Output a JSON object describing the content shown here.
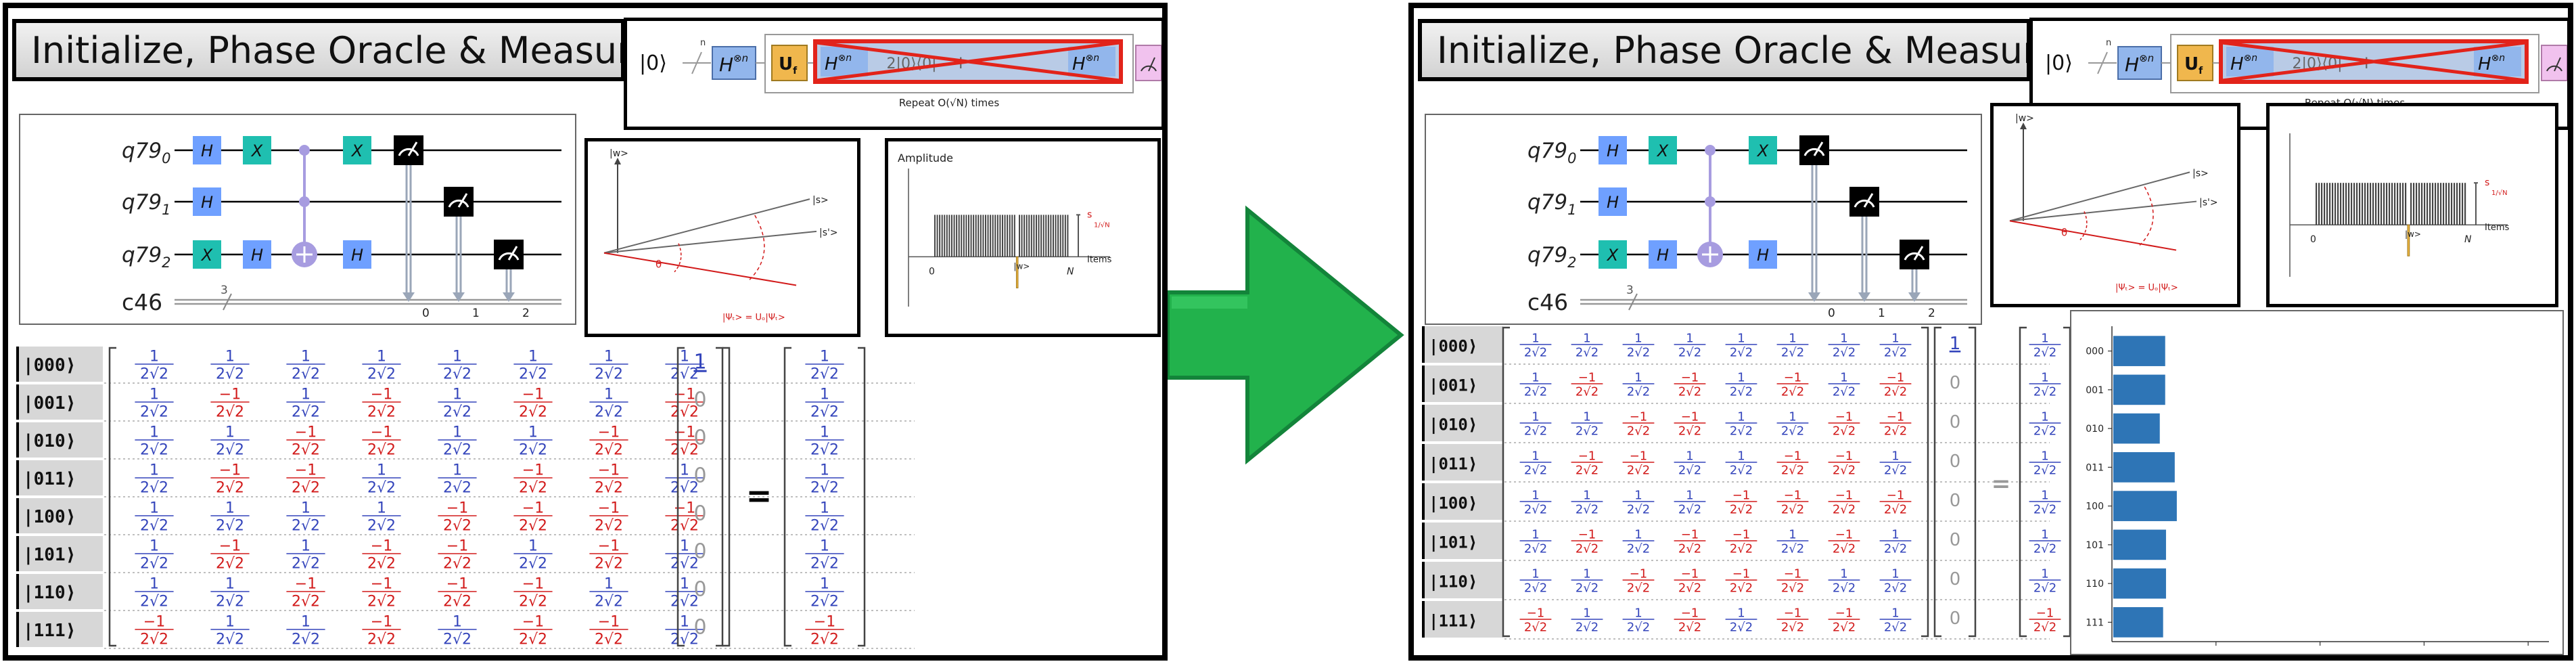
{
  "title": "Initialize, Phase Oracle & Measure",
  "circuit": {
    "qubits": [
      "q79",
      "q79",
      "q79"
    ],
    "qubit_subscripts": [
      "0",
      "1",
      "2"
    ],
    "classical": "c46",
    "classical_width": "3",
    "classical_indices": [
      "0",
      "1",
      "2"
    ],
    "gate_h": "H",
    "gate_x": "X"
  },
  "algorithm_strip": {
    "ket0": "|0⟩",
    "n_label": "n",
    "hadamard": "H",
    "tensor_n": "⊗n",
    "oracle": "U",
    "oracle_sub": "f",
    "diffuser_middle": "2|0⟩⟨0| − I",
    "repeat_text": "Repeat O(√N) times"
  },
  "geometry_plot": {
    "w_label": "|w>",
    "s_label": "|s>",
    "s_prime_label": "|s'>",
    "theta_label": "θ",
    "psi_label": "|Ψₜ> = Uₒ|Ψₜ>"
  },
  "amplitude_plot": {
    "title": "Amplitude",
    "x_start": "0",
    "x_end": "N",
    "items_label": "Items",
    "w_label": "|w>",
    "mean_label": "s",
    "mean_frac": "1/√N"
  },
  "matrix": {
    "kets": [
      "|000⟩",
      "|001⟩",
      "|010⟩",
      "|011⟩",
      "|100⟩",
      "|101⟩",
      "|110⟩",
      "|111⟩"
    ],
    "numerator": "1",
    "numerator_neg": "−1",
    "denominator": "2√2",
    "signs": [
      [
        1,
        1,
        1,
        1,
        1,
        1,
        1,
        1
      ],
      [
        1,
        -1,
        1,
        -1,
        1,
        -1,
        1,
        -1
      ],
      [
        1,
        1,
        -1,
        -1,
        1,
        1,
        -1,
        -1
      ],
      [
        1,
        -1,
        -1,
        1,
        1,
        -1,
        -1,
        1
      ],
      [
        1,
        1,
        1,
        1,
        -1,
        -1,
        -1,
        -1
      ],
      [
        1,
        -1,
        1,
        -1,
        -1,
        1,
        -1,
        1
      ],
      [
        1,
        1,
        -1,
        -1,
        -1,
        -1,
        1,
        1
      ],
      [
        -1,
        1,
        1,
        -1,
        1,
        -1,
        -1,
        1
      ]
    ],
    "input_vector": [
      "1",
      "0",
      "0",
      "0",
      "0",
      "0",
      "0",
      "0"
    ],
    "equals": "=",
    "result_signs": [
      1,
      1,
      1,
      1,
      1,
      1,
      1,
      -1
    ]
  },
  "histogram": {
    "chart_data": {
      "type": "bar",
      "orientation": "horizontal",
      "categories": [
        "000",
        "001",
        "010",
        "011",
        "100",
        "101",
        "110",
        "111"
      ],
      "values": [
        0.125,
        0.125,
        0.112,
        0.148,
        0.153,
        0.127,
        0.127,
        0.12
      ],
      "xlim": [
        0,
        1
      ],
      "title": "",
      "xlabel": "",
      "ylabel": "",
      "bar_color": "#2e75b6"
    }
  },
  "colors": {
    "blue": "#3344bb",
    "red": "#d21a1a",
    "gate_h": "#6fa0ff",
    "gate_x": "#1fbfb0",
    "control": "#a79ce0",
    "arrow_green": "#22b24c",
    "arrow_dark": "#13843a",
    "oracle_yellow": "#f0b74d",
    "diffuser_red": "#e2231a",
    "hist_bar": "#2e75b6"
  }
}
